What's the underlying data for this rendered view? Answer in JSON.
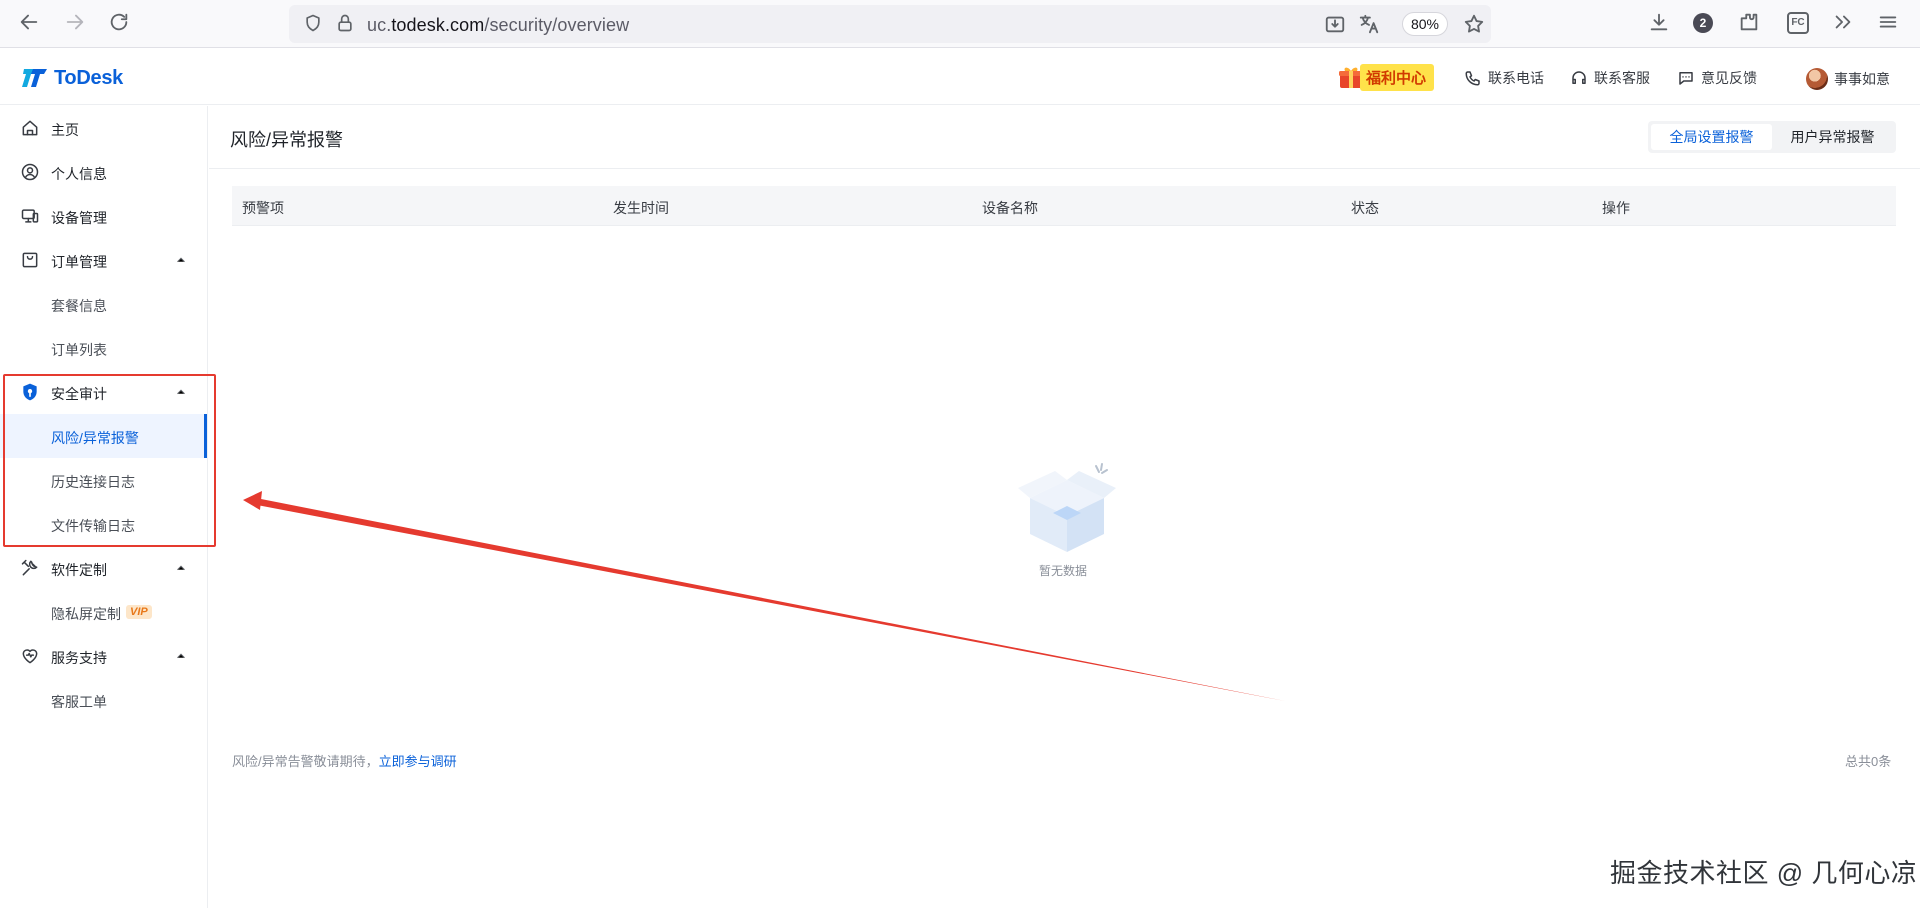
{
  "browser": {
    "url_prefix": "uc.",
    "url_host": "todesk.com",
    "url_path": "/security/overview",
    "zoom": "80%",
    "notification_count": "2",
    "extension_label": "FC"
  },
  "header": {
    "logo_text": "ToDesk",
    "welfare_label": "福利中心",
    "phone_label": "联系电话",
    "service_label": "联系客服",
    "feedback_label": "意见反馈",
    "user_name": "事事如意"
  },
  "sidebar": {
    "items": [
      {
        "label": "主页",
        "icon": "home-icon"
      },
      {
        "label": "个人信息",
        "icon": "user-circle-icon"
      },
      {
        "label": "设备管理",
        "icon": "devices-icon"
      },
      {
        "label": "订单管理",
        "icon": "order-bag-icon"
      },
      {
        "label": "套餐信息"
      },
      {
        "label": "订单列表"
      },
      {
        "label": "安全审计",
        "icon": "shield-icon"
      },
      {
        "label": "风险/异常报警"
      },
      {
        "label": "历史连接日志"
      },
      {
        "label": "文件传输日志"
      },
      {
        "label": "软件定制",
        "icon": "tools-icon"
      },
      {
        "label": "隐私屏定制",
        "badge": "VIP"
      },
      {
        "label": "服务支持",
        "icon": "heart-icon"
      },
      {
        "label": "客服工单"
      }
    ]
  },
  "main": {
    "title": "风险/异常报警",
    "tabs": [
      {
        "label": "全局设置报警",
        "active": true
      },
      {
        "label": "用户异常报警",
        "active": false
      }
    ],
    "table": {
      "columns": [
        "预警项",
        "发生时间",
        "设备名称",
        "状态",
        "操作"
      ],
      "rows": []
    },
    "empty_text": "暂无数据",
    "footer_note": "风险/异常告警敬请期待，",
    "footer_link": "立即参与调研",
    "total": "总共0条"
  },
  "watermark": "掘金技术社区 @ 几何心凉",
  "colors": {
    "accent": "#0a61d9",
    "annotation_red": "#e53a2f",
    "welfare_bg": "#ffe24a"
  }
}
